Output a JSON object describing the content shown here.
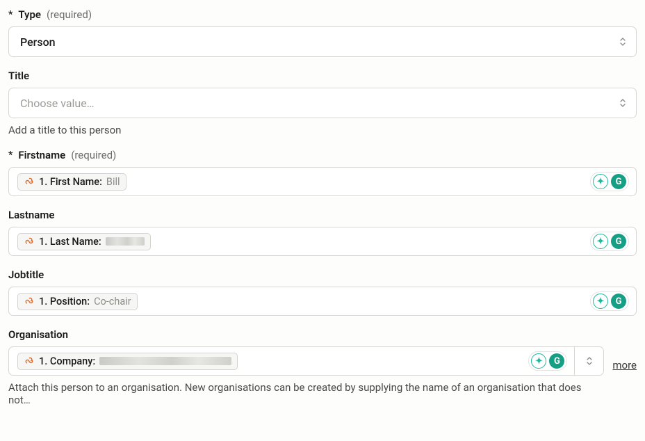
{
  "fields": {
    "type": {
      "label": "Type",
      "required_text": "(required)",
      "selected": "Person"
    },
    "title": {
      "label": "Title",
      "placeholder": "Choose value…",
      "helper": "Add a title to this person"
    },
    "firstname": {
      "label": "Firstname",
      "required_text": "(required)",
      "chip_label": "1. First Name:",
      "chip_value": "Bill"
    },
    "lastname": {
      "label": "Lastname",
      "chip_label": "1. Last Name:"
    },
    "jobtitle": {
      "label": "Jobtitle",
      "chip_label": "1. Position:",
      "chip_value": "Co-chair"
    },
    "organisation": {
      "label": "Organisation",
      "chip_label": "1. Company:",
      "helper": "Attach this person to an organisation. New organisations can be created by supplying the name of an organisation that does not…",
      "more": "more"
    }
  },
  "assist": {
    "a_glyph": "✦",
    "g_glyph": "G"
  }
}
